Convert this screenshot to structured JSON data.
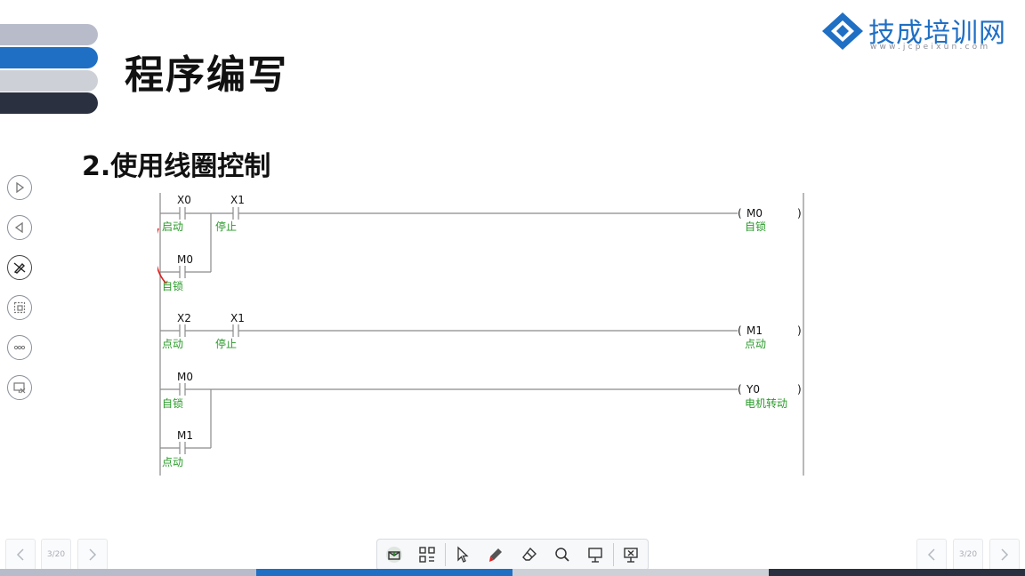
{
  "slide": {
    "title": "程序编写",
    "subtitle": "2.使用线圈控制"
  },
  "logo": {
    "name": "技成培训网",
    "url": "www.jcpeixun.com"
  },
  "side_tools": [
    {
      "name": "next-icon"
    },
    {
      "name": "prev-icon"
    },
    {
      "name": "pen-off-icon"
    },
    {
      "name": "screenshot-icon"
    },
    {
      "name": "more-icon"
    },
    {
      "name": "end-show-icon"
    }
  ],
  "ladder": {
    "rungs": [
      {
        "contacts": [
          {
            "operand": "X0",
            "comment": "启动"
          },
          {
            "operand": "X1",
            "comment": "停止"
          }
        ],
        "parallel": [
          {
            "operand": "M0",
            "comment": "自锁"
          }
        ],
        "coil": {
          "operand": "M0",
          "comment": "自锁"
        }
      },
      {
        "contacts": [
          {
            "operand": "X2",
            "comment": "点动"
          },
          {
            "operand": "X1",
            "comment": "停止"
          }
        ],
        "coil": {
          "operand": "M1",
          "comment": "点动"
        }
      },
      {
        "contacts": [
          {
            "operand": "M0",
            "comment": "自锁"
          }
        ],
        "parallel": [
          {
            "operand": "M1",
            "comment": "点动"
          }
        ],
        "coil": {
          "operand": "Y0",
          "comment": "电机转动"
        }
      }
    ],
    "annotation_color": "#e02020"
  },
  "nav": {
    "left_counter": "3/20",
    "right_counter": "3/20"
  },
  "toolbar": {
    "tools": [
      "thumbnail-icon",
      "grid-icon",
      "pointer-icon",
      "pen-icon",
      "eraser-icon",
      "magnifier-icon",
      "whiteboard-icon",
      "exit-icon"
    ]
  },
  "colors": {
    "accent": "#1f6fc4",
    "dark": "#2b3040",
    "pen": "#e02020"
  }
}
